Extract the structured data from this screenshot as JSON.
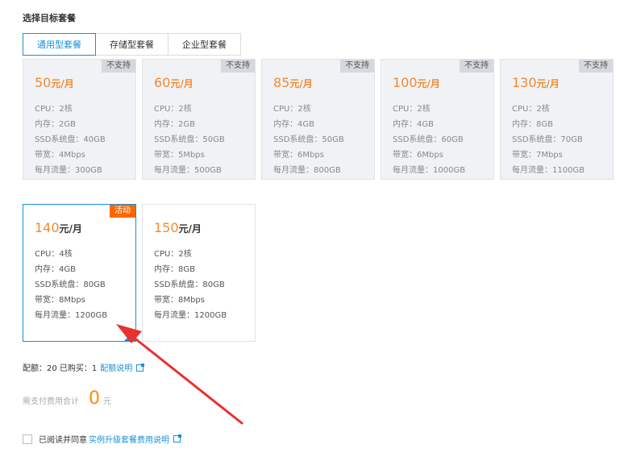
{
  "section_title": "选择目标套餐",
  "tabs": [
    {
      "label": "通用型套餐",
      "active": true
    },
    {
      "label": "存储型套餐",
      "active": false
    },
    {
      "label": "企业型套餐",
      "active": false
    }
  ],
  "plans": [
    {
      "price": "50",
      "unit": "元/月",
      "badge": "不支持",
      "cpu": "CPU：2核",
      "mem": "内存：2GB",
      "disk": "SSD系统盘：40GB",
      "bw": "带宽：4Mbps",
      "traffic": "每月流量：300GB"
    },
    {
      "price": "60",
      "unit": "元/月",
      "badge": "不支持",
      "cpu": "CPU：2核",
      "mem": "内存：2GB",
      "disk": "SSD系统盘：50GB",
      "bw": "带宽：5Mbps",
      "traffic": "每月流量：500GB"
    },
    {
      "price": "85",
      "unit": "元/月",
      "badge": "不支持",
      "cpu": "CPU：2核",
      "mem": "内存：4GB",
      "disk": "SSD系统盘：50GB",
      "bw": "带宽：6Mbps",
      "traffic": "每月流量：800GB"
    },
    {
      "price": "100",
      "unit": "元/月",
      "badge": "不支持",
      "cpu": "CPU：2核",
      "mem": "内存：4GB",
      "disk": "SSD系统盘：60GB",
      "bw": "带宽：6Mbps",
      "traffic": "每月流量：1000GB"
    },
    {
      "price": "130",
      "unit": "元/月",
      "badge": "不支持",
      "cpu": "CPU：2核",
      "mem": "内存：8GB",
      "disk": "SSD系统盘：70GB",
      "bw": "带宽：7Mbps",
      "traffic": "每月流量：1100GB"
    },
    {
      "price": "140",
      "unit": "元/月",
      "badge": "活动",
      "cpu": "CPU：4核",
      "mem": "内存：4GB",
      "disk": "SSD系统盘：80GB",
      "bw": "带宽：8Mbps",
      "traffic": "每月流量：1200GB",
      "selected": true
    },
    {
      "price": "150",
      "unit": "元/月",
      "badge": "",
      "cpu": "CPU：2核",
      "mem": "内存：8GB",
      "disk": "SSD系统盘：80GB",
      "bw": "带宽：8Mbps",
      "traffic": "每月流量：1200GB"
    }
  ],
  "quota": {
    "text": "配额：20  已购买：1",
    "link": "配额说明"
  },
  "total": {
    "label": "需支付费用合计",
    "amount": "0",
    "currency": "元"
  },
  "agree": {
    "prefix": "已阅读并同意",
    "link": "实例升级套餐费用说明"
  },
  "colors": {
    "accent": "#1a8fd8",
    "price": "#f18a32",
    "activity_badge": "#ff6600",
    "arrow": "#e8322d"
  }
}
